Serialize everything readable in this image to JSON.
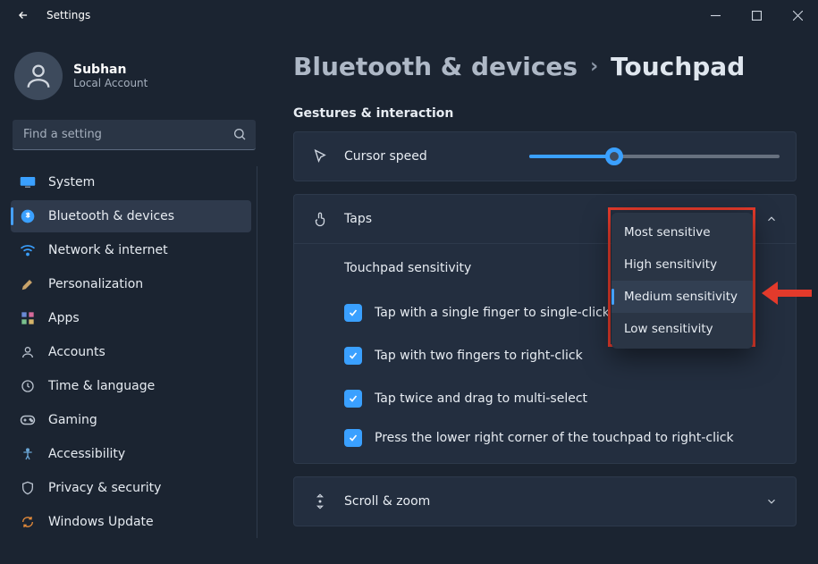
{
  "window": {
    "title": "Settings"
  },
  "profile": {
    "name": "Subhan",
    "sub": "Local Account"
  },
  "search": {
    "placeholder": "Find a setting"
  },
  "nav": [
    {
      "key": "system",
      "label": "System"
    },
    {
      "key": "bluetooth",
      "label": "Bluetooth & devices"
    },
    {
      "key": "network",
      "label": "Network & internet"
    },
    {
      "key": "personalization",
      "label": "Personalization"
    },
    {
      "key": "apps",
      "label": "Apps"
    },
    {
      "key": "accounts",
      "label": "Accounts"
    },
    {
      "key": "time",
      "label": "Time & language"
    },
    {
      "key": "gaming",
      "label": "Gaming"
    },
    {
      "key": "accessibility",
      "label": "Accessibility"
    },
    {
      "key": "privacy",
      "label": "Privacy & security"
    },
    {
      "key": "update",
      "label": "Windows Update"
    }
  ],
  "breadcrumb": {
    "parent": "Bluetooth & devices",
    "current": "Touchpad"
  },
  "section": "Gestures & interaction",
  "cursor_row": {
    "label": "Cursor speed"
  },
  "taps_row": {
    "label": "Taps"
  },
  "sensitivity_row": {
    "label": "Touchpad sensitivity"
  },
  "tap_opts": [
    "Tap with a single finger to single-click",
    "Tap with two fingers to right-click",
    "Tap twice and drag to multi-select",
    "Press the lower right corner of the touchpad to right-click"
  ],
  "scroll_row": {
    "label": "Scroll & zoom"
  },
  "dropdown": {
    "options": [
      "Most sensitive",
      "High sensitivity",
      "Medium sensitivity",
      "Low sensitivity"
    ],
    "selected_index": 2
  }
}
